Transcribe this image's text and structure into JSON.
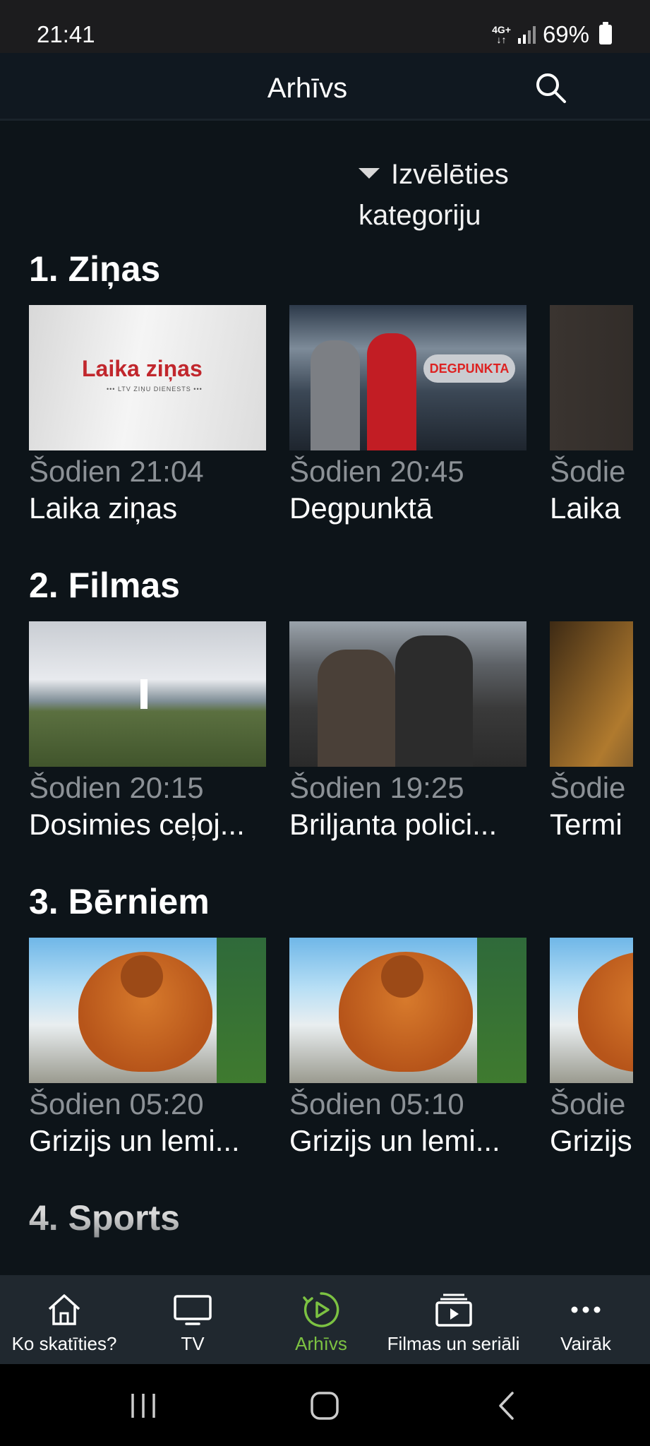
{
  "status_bar": {
    "time": "21:41",
    "network": "4G+",
    "battery": "69%"
  },
  "header": {
    "title": "Arhīvs",
    "search_icon": "search-icon"
  },
  "category_select": {
    "label": "Izvēlēties kategoriju",
    "icon": "triangle-down-icon"
  },
  "sections": [
    {
      "title": "1. Ziņas",
      "items": [
        {
          "time": "Šodien 21:04",
          "title": "Laika ziņas",
          "thumb_text": "Laika ziņas"
        },
        {
          "time": "Šodien 20:45",
          "title": "Degpunktā"
        },
        {
          "time": "Šodie",
          "title": "Laika"
        }
      ]
    },
    {
      "title": "2. Filmas",
      "items": [
        {
          "time": "Šodien 20:15",
          "title": "Dosimies ceļoj..."
        },
        {
          "time": "Šodien 19:25",
          "title": "Briljanta polici..."
        },
        {
          "time": "Šodie",
          "title": "Termi"
        }
      ]
    },
    {
      "title": "3. Bērniem",
      "items": [
        {
          "time": "Šodien 05:20",
          "title": "Grizijs un lemi..."
        },
        {
          "time": "Šodien 05:10",
          "title": "Grizijs un lemi..."
        },
        {
          "time": "Šodie",
          "title": "Grizijs"
        }
      ]
    },
    {
      "title": "4. Sports",
      "items": []
    }
  ],
  "bottom_nav": [
    {
      "label": "Ko skatīties?",
      "icon": "home-icon",
      "active": false
    },
    {
      "label": "TV",
      "icon": "tv-icon",
      "active": false
    },
    {
      "label": "Arhīvs",
      "icon": "play-history-icon",
      "active": true
    },
    {
      "label": "Filmas un seriāli",
      "icon": "video-library-icon",
      "active": false
    },
    {
      "label": "Vairāk",
      "icon": "more-icon",
      "active": false
    }
  ],
  "colors": {
    "background": "#0d1419",
    "accent": "#7cc242",
    "muted_text": "#8c9196"
  }
}
